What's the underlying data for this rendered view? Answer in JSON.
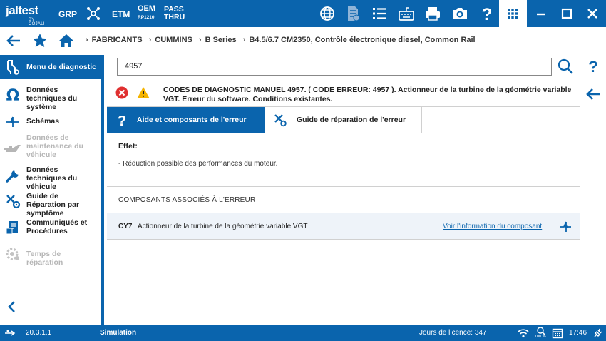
{
  "topbar": {
    "logo_main": "jaltest",
    "logo_sub": "BY COJALI",
    "grp_label": "GRP",
    "etm_label": "ETM",
    "oem_label": "OEM",
    "oem_sub": "RP1210",
    "pass_label": "PASS",
    "thru_label": "THRU",
    "icons": [
      "globe-icon",
      "document-icon",
      "list-icon",
      "keyboard-icon",
      "printer-icon",
      "camera-icon",
      "help-icon",
      "apps-grid-icon",
      "minimize-icon",
      "maximize-icon",
      "close-icon"
    ]
  },
  "breadcrumb": {
    "items": [
      "FABRICANTS",
      "CUMMINS",
      "B Series",
      "B4.5/6.7 CM2350, Contrôle électronique diesel, Common Rail"
    ]
  },
  "sidebar": {
    "active_label": "Menu de diagnostic",
    "items": [
      {
        "label": "Données techniques du système",
        "icon": "omega-icon",
        "enabled": true
      },
      {
        "label": "Schémas",
        "icon": "schematic-icon",
        "enabled": true
      },
      {
        "label": "Données de maintenance du véhicule",
        "icon": "oil-can-icon",
        "enabled": false
      },
      {
        "label": "Données techniques du véhicule",
        "icon": "wrench-icon",
        "enabled": true
      },
      {
        "label": "Guide de Réparation par symptôme",
        "icon": "tools-gear-icon",
        "enabled": true
      },
      {
        "label": "Communiqués et Procédures",
        "icon": "bulletin-icon",
        "enabled": true
      },
      {
        "label": "Temps de réparation",
        "icon": "clock-gear-icon",
        "enabled": false
      }
    ]
  },
  "search": {
    "value": "4957"
  },
  "error": {
    "text": "CODES DE DIAGNOSTIC MANUEL 4957. ( CODE ERREUR: 4957 ). Actionneur de la turbine de la géométrie variable VGT. Erreur du software. Conditions existantes."
  },
  "tabs": [
    {
      "label": "Aide et composants de l'erreur",
      "active": true
    },
    {
      "label": "Guide de réparation de l'erreur",
      "active": false
    }
  ],
  "effect": {
    "title": "Effet:",
    "text": "- Réduction possible des performances du moteur."
  },
  "components": {
    "header": "COMPOSANTS ASSOCIÉS À L'ERREUR",
    "rows": [
      {
        "code": "CY7",
        "description": ", Actionneur de la turbine de la géométrie variable VGT",
        "link": "Voir l'information du composant"
      }
    ]
  },
  "status": {
    "version": "20.3.1.1",
    "mode": "Simulation",
    "license": "Jours de licence: 347",
    "battery": "100 %",
    "time": "17:46"
  },
  "colors": {
    "primary": "#0a64ad",
    "error_red": "#e03030",
    "warning_yellow": "#f5b400",
    "disabled_gray": "#b6b6b6"
  }
}
